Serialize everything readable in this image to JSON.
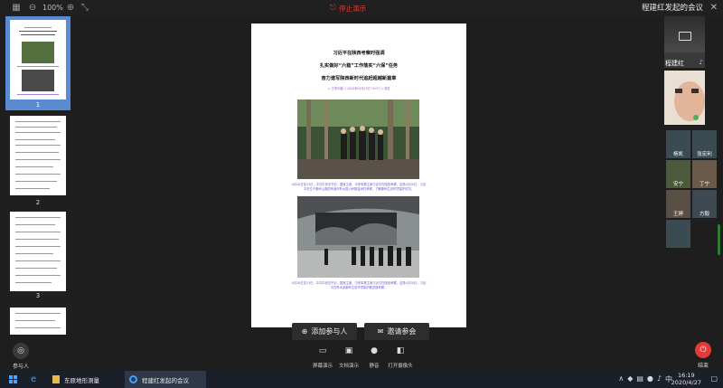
{
  "topbar": {
    "zoom": "100%",
    "stop_share": "停止演示",
    "meeting_title": "程建红发起的会议"
  },
  "thumbnails": {
    "pages": [
      "1",
      "2",
      "3"
    ]
  },
  "document": {
    "headline_1": "习近平在陕西考察时强调",
    "headline_2": "扎实做好“六稳”工作落实“六保”任务",
    "headline_3": "奋力谱写陕西新时代追赶超越新篇章",
    "meta": "○ 王贺平播 ○ 2020年04月23日 19:37 ○ 浏览",
    "caption_1_line_1": "4月20日至23日，中共中央总书记、国家主席、中央军委主席习近平在陕西考察。这是4月20日，习近",
    "caption_1_line_2": "平在位于秦岭山麓的商洛市柞水县小岭镇金米村考察，了解秦岭生态环境保护情况。",
    "caption_2_line_1": "4月20日至23日，中共中央总书记、国家主席、中央军委主席习近平在陕西考察。这是4月20日，习近",
    "caption_2_line_2": "平在柞水县秦岭生态环境保护展览馆考察。"
  },
  "participants": {
    "host_name": "程建红",
    "tiles": [
      "杨凯",
      "张宏利",
      "安宁",
      "丁宁",
      "王婷",
      "方毅",
      ""
    ]
  },
  "toolbar": {
    "add_participant": "添加参与人",
    "invite": "邀请参会",
    "participants": "参与人",
    "screen_share": "屏幕演示",
    "doc_share": "文档演示",
    "mute": "静音",
    "camera": "打开摄像头",
    "end": "结束"
  },
  "taskbar": {
    "app_1": "东原地形测量",
    "app_2": "程建红发起的会议",
    "time": "16:19",
    "date": "2020/4/27",
    "ime": "中"
  },
  "colors": {
    "accent_red": "#e53935",
    "selection_blue": "#5a8bd0",
    "caption_purple": "#6a5acd"
  }
}
